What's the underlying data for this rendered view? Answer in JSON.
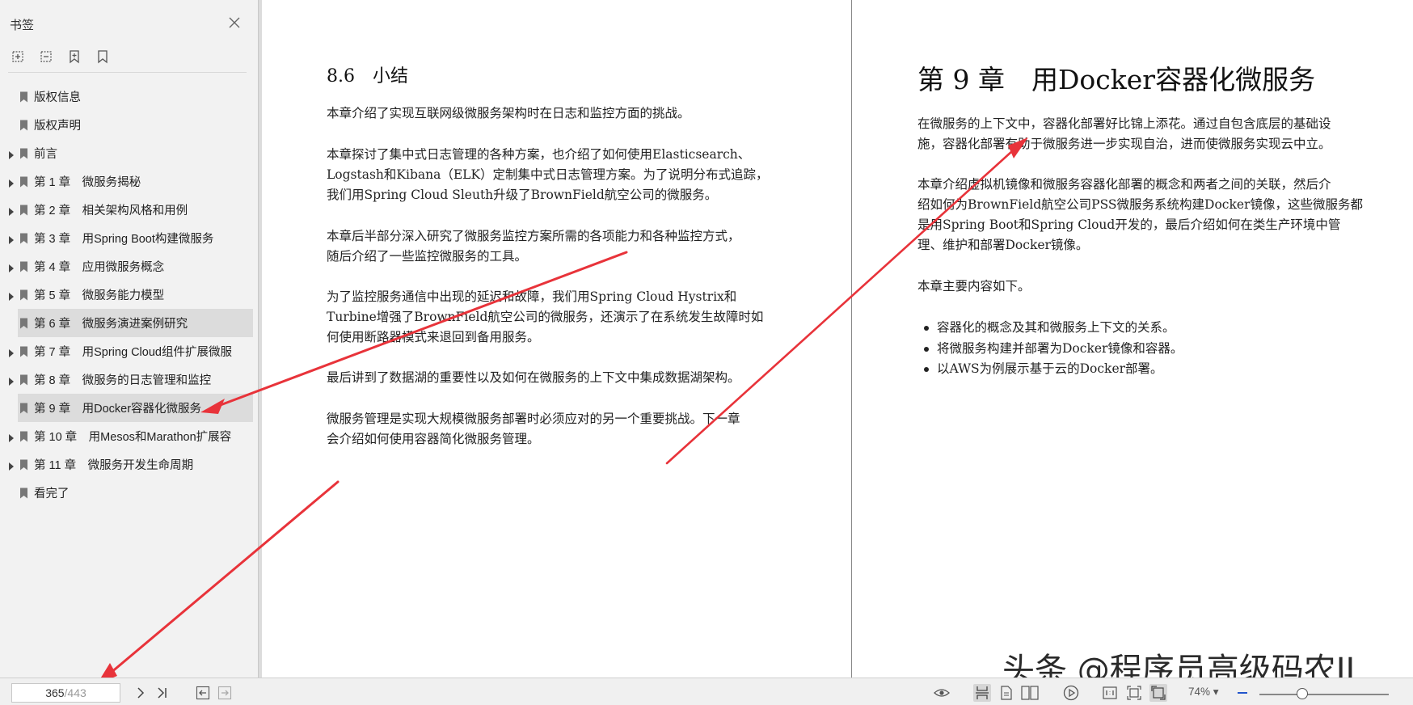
{
  "sidebar": {
    "title": "书签",
    "bookmarks": [
      {
        "label": "版权信息",
        "expandable": false
      },
      {
        "label": "版权声明",
        "expandable": false
      },
      {
        "label": "前言",
        "expandable": true
      },
      {
        "label": "第 1 章　微服务揭秘",
        "expandable": true
      },
      {
        "label": "第 2 章　相关架构风格和用例",
        "expandable": true
      },
      {
        "label": "第 3 章　用Spring Boot构建微服务",
        "expandable": true
      },
      {
        "label": "第 4 章　应用微服务概念",
        "expandable": true
      },
      {
        "label": "第 5 章　微服务能力模型",
        "expandable": true
      },
      {
        "label": "第 6 章　微服务演进案例研究",
        "expandable": true
      },
      {
        "label": "第 7 章　用Spring Cloud组件扩展微服",
        "expandable": true
      },
      {
        "label": "第 8 章　微服务的日志管理和监控",
        "expandable": true
      },
      {
        "label": "第 9 章　用Docker容器化微服务",
        "expandable": true
      },
      {
        "label": "第 10 章　用Mesos和Marathon扩展容",
        "expandable": true
      },
      {
        "label": "第 11 章　微服务开发生命周期",
        "expandable": true
      },
      {
        "label": "看完了",
        "expandable": false
      }
    ]
  },
  "left_page": {
    "heading": "8.6　小结",
    "paragraphs": [
      [
        "本章介绍了实现互联网级微服务架构时在日志和监控方面的挑战。"
      ],
      [
        "本章探讨了集中式日志管理的各种方案，也介绍了如何使用Elasticsearch、",
        "Logstash和Kibana（ELK）定制集中式日志管理方案。为了说明分布式追踪，",
        "我们用Spring Cloud Sleuth升级了BrownField航空公司的微服务。"
      ],
      [
        "本章后半部分深入研究了微服务监控方案所需的各项能力和各种监控方式，",
        "随后介绍了一些监控微服务的工具。"
      ],
      [
        "为了监控服务通信中出现的延迟和故障，我们用Spring Cloud Hystrix和",
        "Turbine增强了BrownField航空公司的微服务，还演示了在系统发生故障时如",
        "何使用断路器模式来退回到备用服务。"
      ],
      [
        "最后讲到了数据湖的重要性以及如何在微服务的上下文中集成数据湖架构。"
      ],
      [
        "微服务管理是实现大规模微服务部署时必须应对的另一个重要挑战。下一章",
        "会介绍如何使用容器简化微服务管理。"
      ]
    ]
  },
  "right_page": {
    "heading": "第 9 章　用Docker容器化微服务",
    "paragraphs": [
      [
        "在微服务的上下文中，容器化部署好比锦上添花。通过自包含底层的基础设",
        "施，容器化部署有助于微服务进一步实现自治，进而使微服务实现云中立。"
      ],
      [
        "本章介绍虚拟机镜像和微服务容器化部署的概念和两者之间的关联，然后介",
        "绍如何为BrownField航空公司PSS微服务系统构建Docker镜像，这些微服务都",
        "是用Spring Boot和Spring Cloud开发的，最后介绍如何在类生产环境中管",
        "理、维护和部署Docker镜像。"
      ],
      [
        "本章主要内容如下。"
      ]
    ],
    "bullets": [
      "容器化的概念及其和微服务上下文的关系。",
      "将微服务构建并部署为Docker镜像和容器。",
      "以AWS为例展示基于云的Docker部署。"
    ]
  },
  "watermark": "头条 @程序员高级码农II",
  "statusbar": {
    "current_page": "365",
    "total_pages": "/443",
    "zoom": "74%",
    "zoom_fraction": 0.33
  },
  "colors": {
    "annotation_arrow": "#e8333a",
    "sidebar_bg": "#f2f2f2",
    "highlight_row": "#dcdcdc"
  }
}
